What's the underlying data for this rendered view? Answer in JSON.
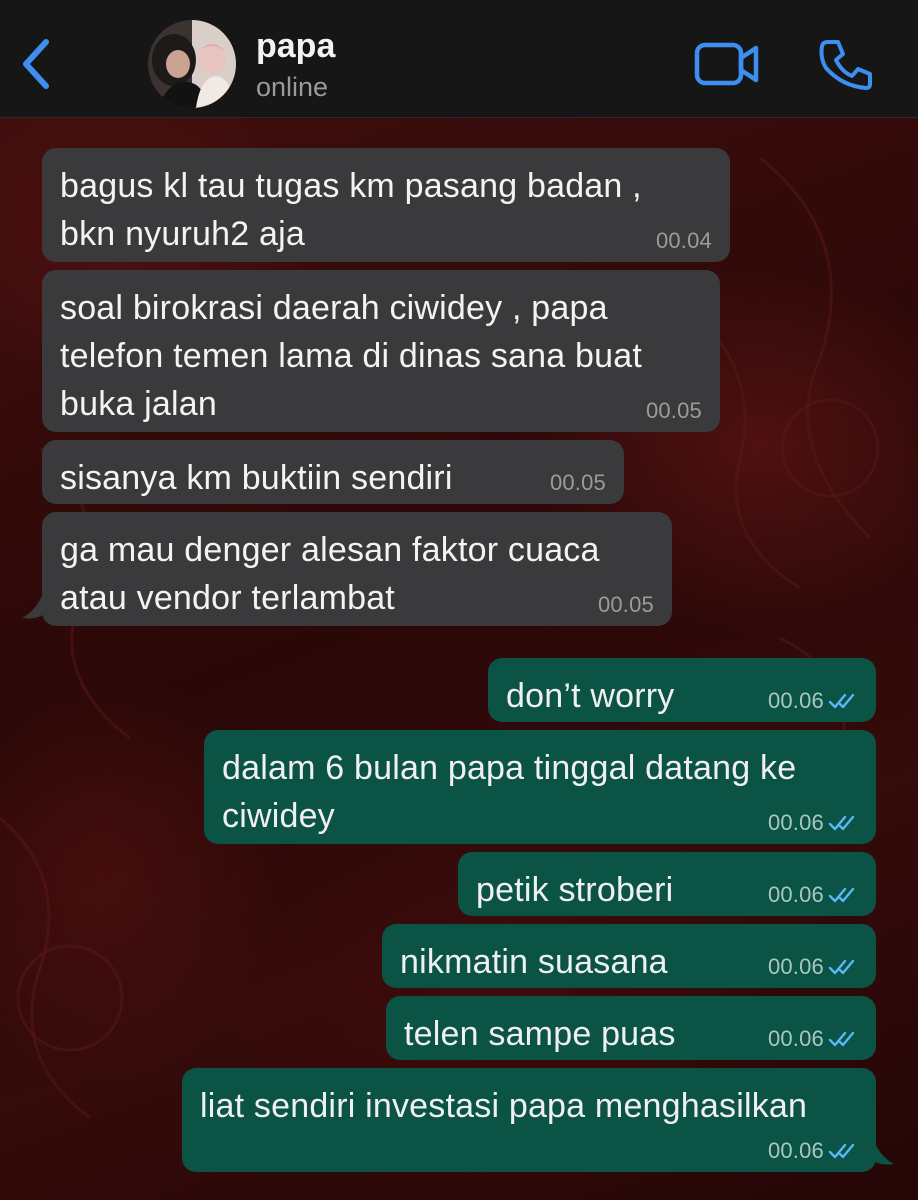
{
  "contact": {
    "name": "papa",
    "status": "online"
  },
  "icons": {
    "back": "chevron-left-icon",
    "video": "video-camera-icon",
    "call": "phone-icon",
    "read_receipt": "double-check-icon"
  },
  "colors": {
    "accent": "#3d8ef0",
    "incoming_bubble": "#3a3a3c",
    "outgoing_bubble": "#0b5345",
    "read_tick": "#5ab7f5"
  },
  "messages": [
    {
      "direction": "incoming",
      "lines": [
        "bagus kl tau tugas km pasang badan ,",
        "bkn nyuruh2 aja"
      ],
      "time": "00.04"
    },
    {
      "direction": "incoming",
      "lines": [
        "soal birokrasi daerah ciwidey , papa",
        "telefon temen lama di dinas sana buat",
        "buka jalan"
      ],
      "time": "00.05"
    },
    {
      "direction": "incoming",
      "lines": [
        "sisanya km buktiin sendiri"
      ],
      "time": "00.05"
    },
    {
      "direction": "incoming",
      "lines": [
        "ga mau denger alesan faktor cuaca",
        "atau vendor terlambat"
      ],
      "time": "00.05"
    },
    {
      "direction": "outgoing",
      "lines": [
        "don’t worry"
      ],
      "time": "00.06",
      "read": true
    },
    {
      "direction": "outgoing",
      "lines": [
        "dalam 6 bulan papa tinggal datang ke",
        "ciwidey"
      ],
      "time": "00.06",
      "read": true
    },
    {
      "direction": "outgoing",
      "lines": [
        "petik stroberi"
      ],
      "time": "00.06",
      "read": true
    },
    {
      "direction": "outgoing",
      "lines": [
        "nikmatin suasana"
      ],
      "time": "00.06",
      "read": true
    },
    {
      "direction": "outgoing",
      "lines": [
        "telen sampe puas"
      ],
      "time": "00.06",
      "read": true
    },
    {
      "direction": "outgoing",
      "lines": [
        "liat sendiri investasi papa menghasilkan"
      ],
      "time": "00.06",
      "read": true
    }
  ]
}
